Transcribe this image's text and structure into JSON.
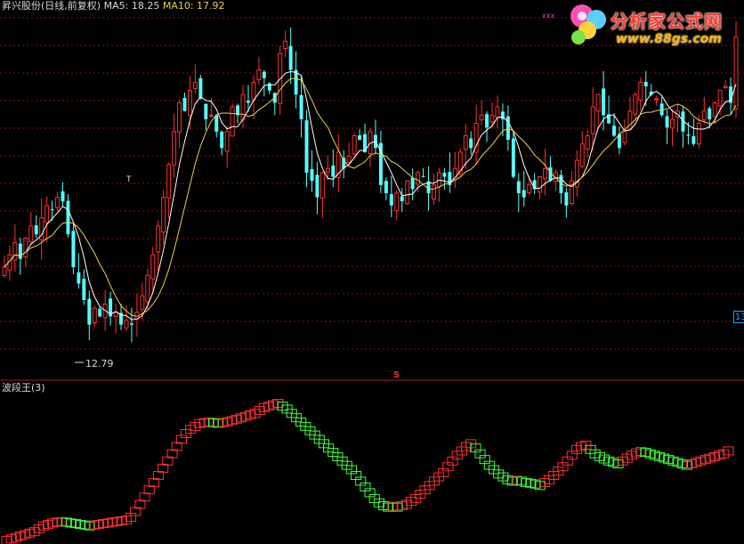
{
  "header": {
    "title": "昇兴股份(日线,前复权)",
    "ma5_label": "MA5:",
    "ma5_value": "18.25",
    "ma10_label": "MA10:",
    "ma10_value": "17.92"
  },
  "sub_header": {
    "title": "波段王(3)"
  },
  "annotations": {
    "min_price": "12.79",
    "right_edge": "13",
    "s_marker": "S",
    "top_mark": "xxx",
    "t_mark": "T"
  },
  "watermark": {
    "title": "分析家公式网",
    "url": "www.88gs.com"
  },
  "colors": {
    "up": "#ff3030",
    "down": "#54ffff",
    "ma5": "#ffffff",
    "ma10": "#e8d050",
    "grid": "#8a1010",
    "wave_up": "#ff3030",
    "wave_down": "#40ff40"
  },
  "chart_data": [
    {
      "type": "candlestick",
      "title": "昇兴股份(日线,前复权)",
      "ylim": [
        12.0,
        20.8
      ],
      "grid": true,
      "series": [
        {
          "name": "MA5"
        },
        {
          "name": "MA10"
        }
      ],
      "annotation_min": 12.79,
      "closes": [
        14.6,
        14.9,
        15.2,
        14.8,
        15.3,
        15.6,
        15.4,
        15.8,
        16.1,
        16.0,
        16.3,
        16.2,
        15.4,
        14.6,
        14.2,
        13.8,
        13.2,
        13.6,
        13.4,
        13.7,
        13.4,
        13.5,
        13.2,
        13.3,
        13.2,
        13.5,
        13.9,
        14.4,
        14.9,
        15.6,
        16.3,
        17.1,
        17.9,
        18.6,
        18.4,
        18.9,
        19.1,
        18.7,
        18.2,
        18.3,
        17.9,
        17.5,
        17.9,
        18.5,
        18.3,
        18.8,
        18.6,
        19.1,
        19.4,
        19.2,
        18.9,
        18.6,
        19.8,
        20.1,
        19.4,
        18.8,
        18.2,
        16.9,
        16.7,
        16.3,
        16.9,
        17.0,
        16.8,
        17.4,
        17.0,
        17.3,
        17.8,
        17.7,
        17.4,
        17.9,
        17.5,
        16.6,
        16.4,
        16.1,
        16.4,
        16.2,
        16.7,
        16.5,
        16.9,
        16.8,
        16.4,
        16.6,
        16.9,
        16.8,
        16.6,
        17.0,
        17.4,
        17.8,
        17.5,
        18.1,
        18.3,
        18.0,
        18.3,
        18.5,
        18.2,
        17.7,
        16.8,
        16.4,
        16.3,
        16.6,
        16.5,
        16.8,
        17.0,
        16.7,
        16.9,
        16.4,
        16.1,
        16.7,
        17.2,
        17.6,
        17.8,
        18.5,
        18.8,
        18.3,
        18.1,
        17.8,
        17.5,
        17.9,
        18.4,
        18.8,
        19.1,
        19.0,
        18.8,
        18.7,
        18.3,
        18.0,
        18.2,
        18.4,
        17.9,
        17.8,
        17.6,
        18.1,
        18.4,
        18.2,
        18.6,
        18.9,
        19.0,
        18.6,
        20.2
      ]
    },
    {
      "type": "step",
      "title": "波段王(3)",
      "values": [
        0.5,
        1.0,
        1.5,
        2.0,
        2.5,
        3.0,
        3.5,
        4.5,
        5.5,
        6.0,
        6.5,
        6.8,
        7.0,
        6.8,
        6.5,
        6.3,
        6.0,
        5.8,
        5.5,
        5.8,
        6.0,
        6.3,
        6.5,
        6.8,
        7.0,
        7.3,
        7.5,
        8.5,
        10.5,
        13.0,
        15.5,
        18.0,
        20.5,
        23.0,
        25.5,
        28.0,
        30.5,
        33.0,
        35.5,
        37.5,
        39.0,
        40.0,
        41.0,
        41.3,
        41.5,
        41.3,
        41.1,
        41.3,
        41.6,
        42.0,
        42.5,
        43.0,
        43.5,
        44.0,
        44.5,
        45.5,
        46.5,
        47.0,
        47.5,
        48.0,
        47.0,
        46.0,
        44.5,
        43.0,
        41.5,
        40.0,
        38.5,
        37.0,
        35.5,
        34.0,
        32.5,
        31.0,
        29.5,
        28.0,
        26.5,
        25.0,
        23.0,
        21.0,
        19.0,
        17.0,
        15.0,
        13.5,
        12.5,
        12.0,
        12.3,
        12.0,
        12.5,
        13.0,
        14.0,
        15.0,
        16.5,
        18.0,
        19.5,
        21.0,
        22.5,
        24.0,
        26.0,
        28.0,
        30.0,
        31.5,
        33.0,
        34.0,
        32.5,
        30.5,
        28.5,
        26.5,
        25.0,
        23.5,
        22.5,
        21.5,
        21.0,
        21.3,
        21.0,
        20.5,
        20.3,
        20.0,
        19.5,
        20.5,
        21.5,
        23.0,
        24.5,
        26.0,
        28.0,
        30.0,
        32.0,
        33.0,
        33.5,
        32.0,
        30.5,
        29.5,
        28.7,
        28.0,
        27.5,
        27.0,
        28.0,
        29.0,
        30.0,
        30.8,
        31.3,
        31.0,
        30.5,
        30.0,
        29.5,
        29.0,
        28.5,
        28.0,
        27.5,
        27.0,
        26.5,
        27.0,
        27.5,
        28.0,
        28.5,
        29.0,
        29.5,
        30.0,
        30.5,
        31.5
      ],
      "ylim": [
        0,
        50
      ]
    }
  ]
}
